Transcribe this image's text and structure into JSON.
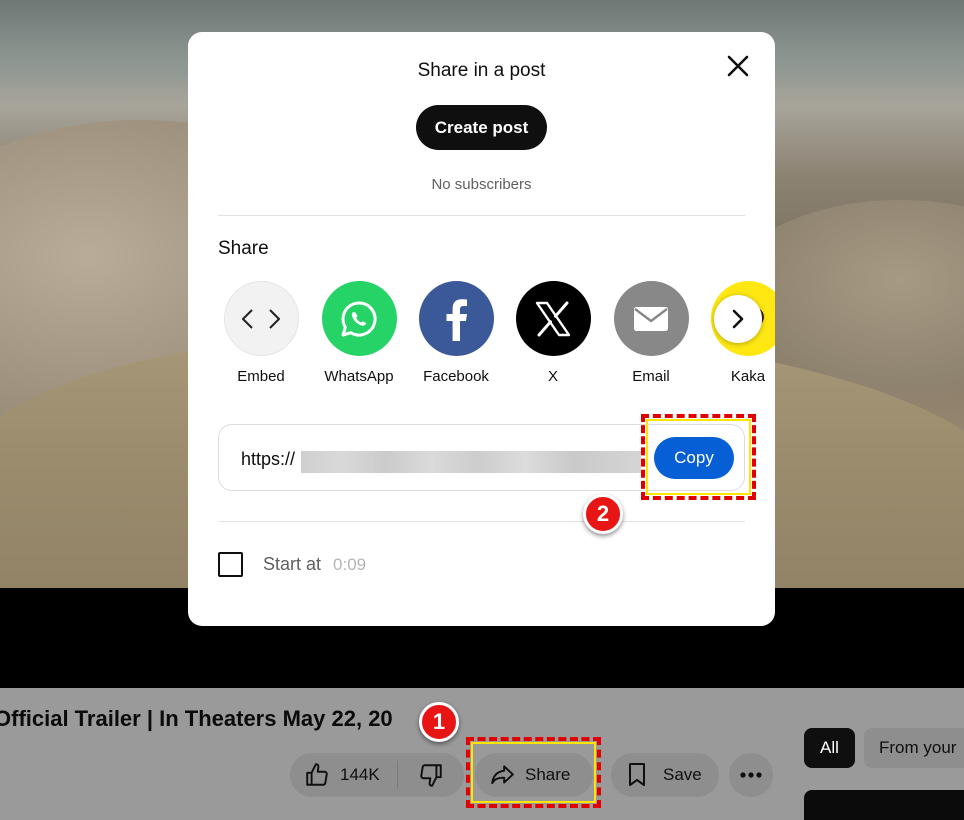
{
  "modal": {
    "title": "Share in a post",
    "create_post_label": "Create post",
    "subscribers_text": "No subscribers",
    "share_heading": "Share",
    "share_targets": [
      {
        "label": "Embed",
        "icon": "embed-icon",
        "color": "#f2f2f2"
      },
      {
        "label": "WhatsApp",
        "icon": "whatsapp-icon",
        "color": "#25d366"
      },
      {
        "label": "Facebook",
        "icon": "facebook-icon",
        "color": "#3b5998"
      },
      {
        "label": "X",
        "icon": "x-icon",
        "color": "#000000"
      },
      {
        "label": "Email",
        "icon": "email-icon",
        "color": "#888888"
      },
      {
        "label": "Kaka",
        "icon": "kakaotalk-icon",
        "color": "#ffe812"
      }
    ],
    "url_prefix": "https://",
    "copy_label": "Copy",
    "start_at_label": "Start at",
    "start_at_time": "0:09"
  },
  "page": {
    "video_title": "Official Trailer | In Theaters May 22, 20",
    "like_count": "144K",
    "share_label": "Share",
    "save_label": "Save",
    "chip_all": "All",
    "chip_from": "From your"
  },
  "annotations": {
    "badge_1": "1",
    "badge_2": "2",
    "highlight_color": "#e00000"
  },
  "colors": {
    "copy_button": "#065fd4",
    "create_button": "#0f0f0f"
  }
}
